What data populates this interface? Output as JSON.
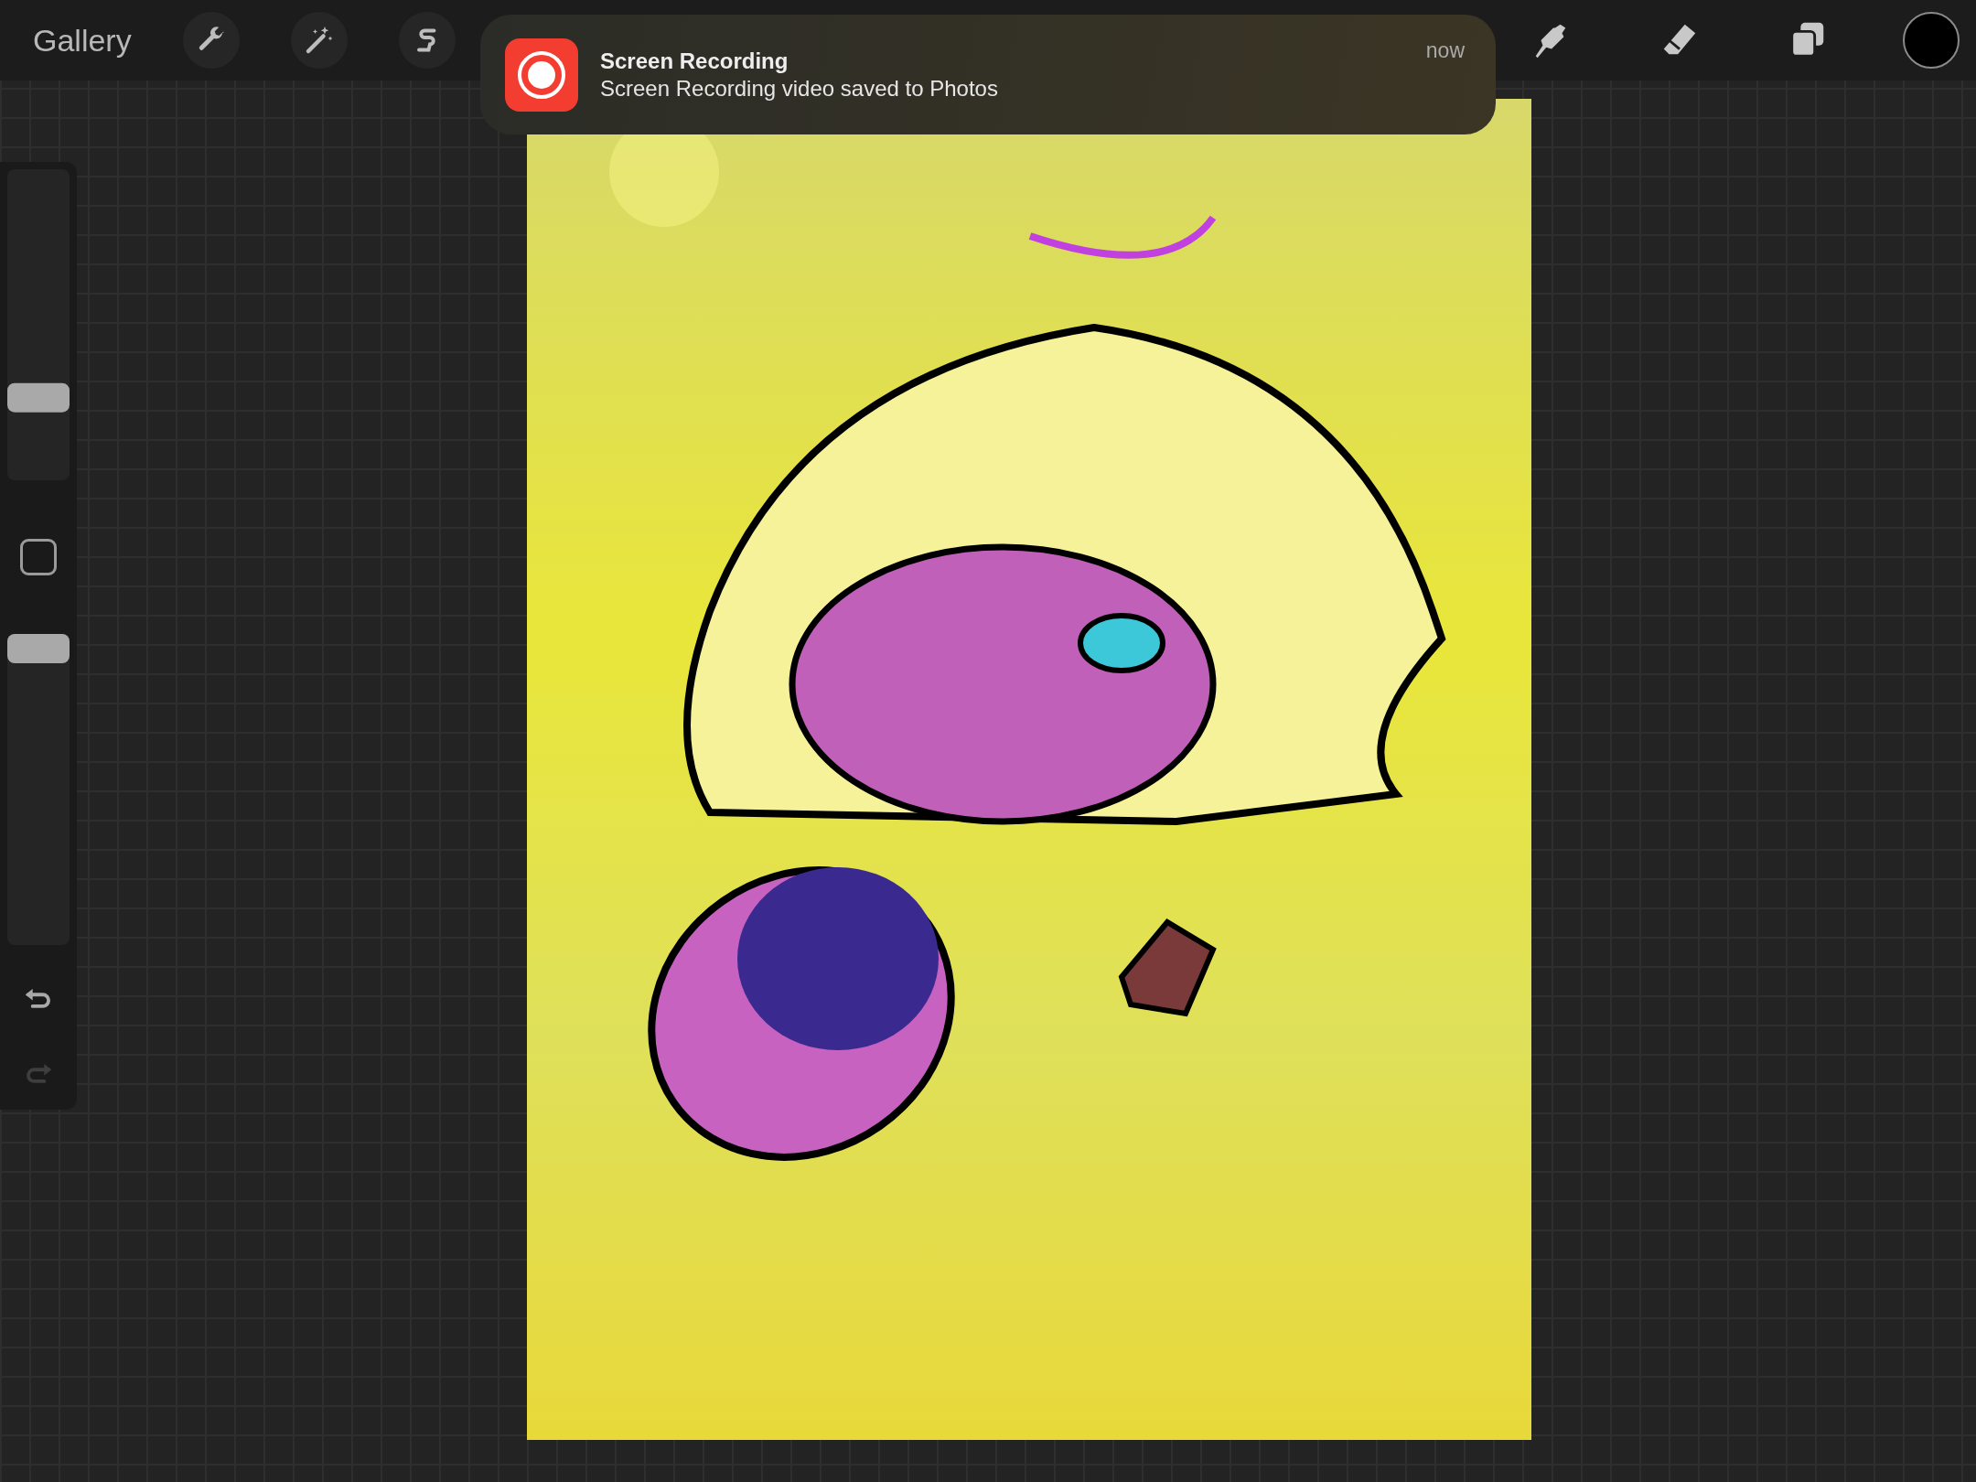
{
  "toolbar": {
    "gallery": "Gallery"
  },
  "notification": {
    "title": "Screen Recording",
    "message": "Screen Recording video saved to Photos",
    "time": "now"
  },
  "sidebar": {
    "size_slider": {
      "level": 0.24
    },
    "opacity_slider": {
      "level": 1.0
    },
    "undo": {
      "disabled": false
    },
    "redo": {
      "disabled": true
    }
  }
}
